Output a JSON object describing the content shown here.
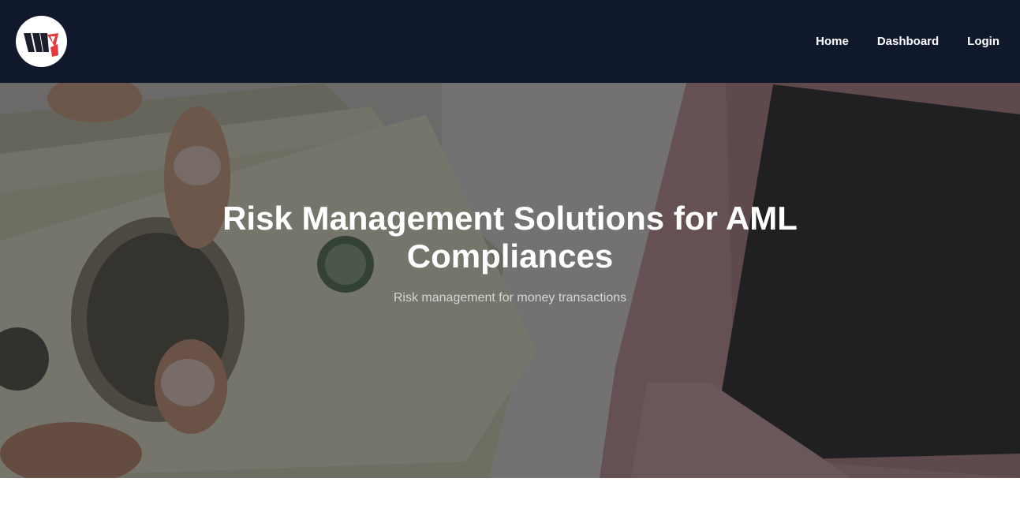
{
  "brand": {
    "logo_icon": "w4-logo-icon",
    "colors": {
      "navbar": "#10182c",
      "accent": "#e23b3b"
    }
  },
  "nav": {
    "items": [
      {
        "label": "Home"
      },
      {
        "label": "Dashboard"
      },
      {
        "label": "Login"
      }
    ]
  },
  "hero": {
    "title": "Risk Management Solutions for AML Compliances",
    "subtitle": "Risk management for money transactions",
    "background_icon": "money-banknotes-image"
  }
}
